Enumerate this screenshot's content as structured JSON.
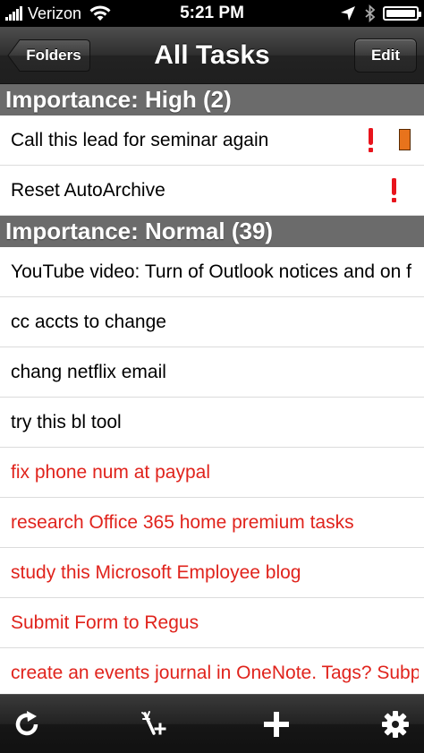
{
  "status_bar": {
    "carrier": "Verizon",
    "time": "5:21 PM",
    "battery_level": 1.0
  },
  "nav_bar": {
    "back_label": "Folders",
    "title": "All Tasks",
    "edit_label": "Edit"
  },
  "sections": [
    {
      "header": "Importance: High (2)",
      "rows": [
        {
          "text": "Call this lead  for seminar again",
          "important": true,
          "flag": true,
          "overdue": false
        },
        {
          "text": "Reset AutoArchive",
          "important": true,
          "flag": false,
          "overdue": false
        }
      ]
    },
    {
      "header": "Importance: Normal (39)",
      "rows": [
        {
          "text": "YouTube video: Turn of Outlook notices and on f",
          "important": false,
          "flag": false,
          "overdue": false
        },
        {
          "text": "cc accts to change",
          "important": false,
          "flag": false,
          "overdue": false
        },
        {
          "text": "chang netflix email",
          "important": false,
          "flag": false,
          "overdue": false
        },
        {
          "text": "try this bl tool",
          "important": false,
          "flag": false,
          "overdue": false
        },
        {
          "text": "fix phone num at paypal",
          "important": false,
          "flag": false,
          "overdue": true
        },
        {
          "text": "research Office 365 home premium tasks",
          "important": false,
          "flag": false,
          "overdue": true
        },
        {
          "text": "study this Microsoft Employee blog",
          "important": false,
          "flag": false,
          "overdue": true
        },
        {
          "text": "Submit Form to Regus",
          "important": false,
          "flag": false,
          "overdue": true
        },
        {
          "text": "create an events journal in OneNote. Tags? Subp",
          "important": false,
          "flag": false,
          "overdue": true
        }
      ]
    }
  ],
  "tab_bar": {
    "icons": [
      "refresh-icon",
      "magic-wand-add-icon",
      "plus-icon",
      "gear-icon"
    ]
  },
  "colors": {
    "overdue_text": "#e0231c",
    "importance_icon": "#e8141c",
    "flag": "#e8731c",
    "section_header": "#6b6b6b"
  }
}
